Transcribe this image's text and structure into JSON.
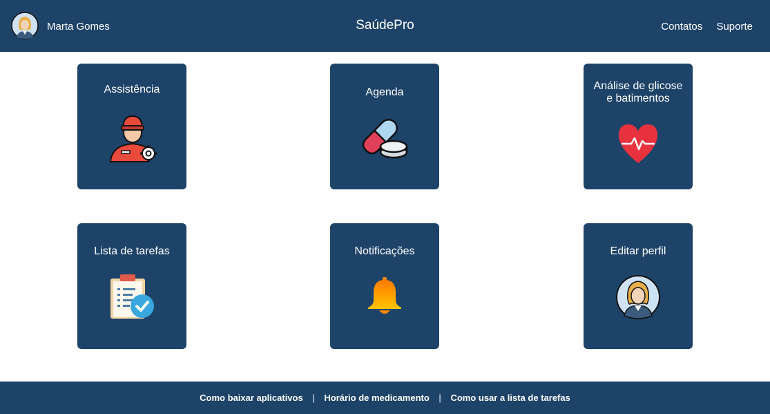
{
  "header": {
    "user_name": "Marta Gomes",
    "title": "SaúdePro",
    "nav": [
      "Contatos",
      "Suporte"
    ]
  },
  "cards": [
    {
      "label": "Assistência",
      "icon": "technician-icon"
    },
    {
      "label": "Agenda",
      "icon": "pills-icon"
    },
    {
      "label": "Análise de glicose e batimentos",
      "icon": "heartbeat-icon"
    },
    {
      "label": "Lista de tarefas",
      "icon": "checklist-icon"
    },
    {
      "label": "Notificações",
      "icon": "bell-icon"
    },
    {
      "label": "Editar perfil",
      "icon": "avatar-icon"
    }
  ],
  "footer": {
    "links": [
      "Como baixar aplicativos",
      "Horário de medicamento",
      "Como usar a lista de tarefas"
    ],
    "separator": "|"
  },
  "colors": {
    "primary": "#1e4369",
    "background": "#ffffff"
  }
}
